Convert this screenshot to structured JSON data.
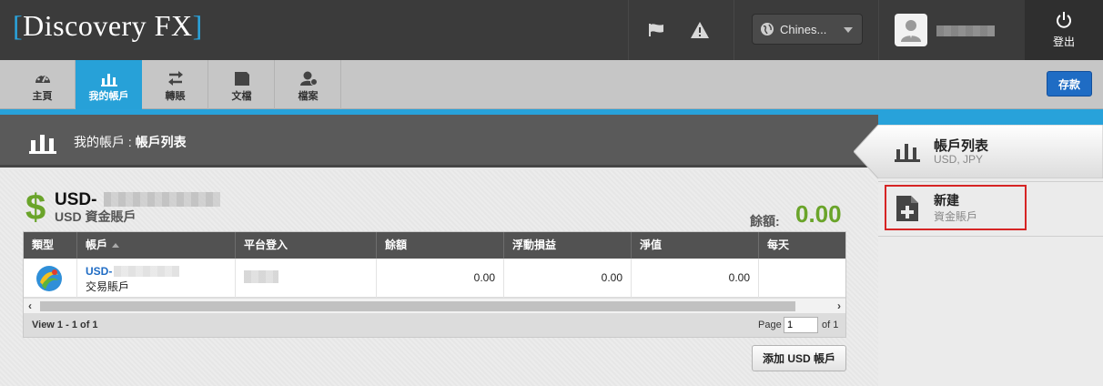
{
  "header": {
    "logo_left": "[",
    "logo_text": "Discovery FX",
    "logo_right": "]",
    "language": "Chines...",
    "logout_label": "登出"
  },
  "nav": {
    "items": [
      {
        "label": "主頁",
        "icon": "dashboard-icon"
      },
      {
        "label": "我的帳戶",
        "icon": "bar-chart-icon"
      },
      {
        "label": "轉賬",
        "icon": "transfer-arrows-icon"
      },
      {
        "label": "文檔",
        "icon": "folder-icon"
      },
      {
        "label": "檔案",
        "icon": "profile-icon"
      }
    ],
    "active_index": 1,
    "deposit_label": "存款"
  },
  "page": {
    "breadcrumb_prefix": "我的帳戶 : ",
    "breadcrumb_current": "帳戶列表"
  },
  "account": {
    "currency_symbol": "$",
    "title": "USD-",
    "subtitle": "USD 資金賬戶",
    "balance_label": "餘額:",
    "balance_value": "0.00"
  },
  "grid": {
    "columns": [
      "類型",
      "帳戶",
      "平台登入",
      "餘額",
      "浮動損益",
      "淨值",
      "每天"
    ],
    "sorted_column": 1,
    "rows": [
      {
        "account_prefix": "USD-",
        "account_type": "交易賬戶",
        "balance": "0.00",
        "floating_pl": "0.00",
        "equity": "0.00",
        "daily": ""
      }
    ],
    "footer_view": "View 1 - 1 of 1",
    "page_label": "Page",
    "page_value": "1",
    "page_of": "of 1"
  },
  "add_button_label": "添加 USD 帳戶",
  "sidebar": {
    "list_title": "帳戶列表",
    "list_sub": "USD, JPY",
    "new_title": "新建",
    "new_sub": "資金賬戶"
  },
  "colors": {
    "accent_blue": "#28a2da",
    "balance_green": "#6aa42a",
    "highlight_red": "#d62424"
  }
}
